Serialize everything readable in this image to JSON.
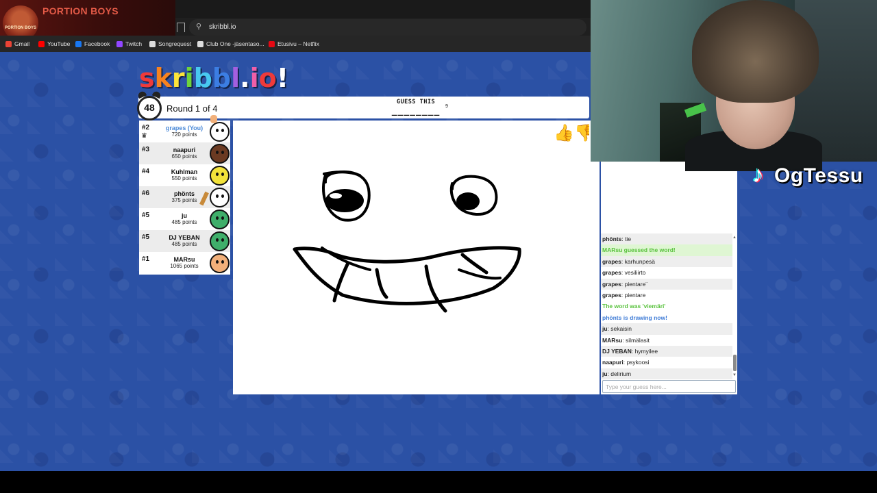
{
  "browser": {
    "url": "skribbl.io",
    "bookmarks": [
      {
        "label": "Gmail",
        "icon": "gmail-icon",
        "color": "#ea4335"
      },
      {
        "label": "YouTube",
        "icon": "youtube-icon",
        "color": "#ff0000"
      },
      {
        "label": "Facebook",
        "icon": "facebook-icon",
        "color": "#1877f2"
      },
      {
        "label": "Twitch",
        "icon": "twitch-icon",
        "color": "#9146ff"
      },
      {
        "label": "Songrequest",
        "icon": "diamond-icon",
        "color": "#dddddd"
      },
      {
        "label": "Club One -jäsentaso...",
        "icon": "club-icon",
        "color": "#dddddd"
      },
      {
        "label": "Etusivu – Netflix",
        "icon": "netflix-icon",
        "color": "#e50914"
      }
    ]
  },
  "banner": {
    "title": "PORTION BOYS",
    "logo_text": "PORTION BOYS"
  },
  "game": {
    "logo_letters": [
      "s",
      "k",
      "r",
      "i",
      "b",
      "b",
      "l",
      ".",
      "i",
      "o",
      "!"
    ],
    "logo_colors": [
      "#ef3a3a",
      "#f7821f",
      "#fde53a",
      "#6fd33c",
      "#48c8f0",
      "#3c7ee3",
      "#a45fe0",
      "#ffffff",
      "#ef5fa8",
      "#ef3a3a",
      "#ffffff"
    ],
    "timer": "48",
    "round": "Round 1 of 4",
    "guess_label": "GUESS THIS",
    "word_hint": "________",
    "word_length": "9",
    "players": [
      {
        "rank": "#2",
        "name": "grapes (You)",
        "points": "720 points",
        "is_you": true,
        "crown": true,
        "avatar_color": "#ffffff"
      },
      {
        "rank": "#3",
        "name": "naapuri",
        "points": "650 points",
        "avatar_color": "#6b3a22"
      },
      {
        "rank": "#4",
        "name": "Kuhlman",
        "points": "550 points",
        "avatar_color": "#f2e23a"
      },
      {
        "rank": "#6",
        "name": "phönts",
        "points": "375 points",
        "drawing": true,
        "avatar_color": "#ffffff"
      },
      {
        "rank": "#5",
        "name": "ju",
        "points": "485 points",
        "avatar_color": "#3fae6a"
      },
      {
        "rank": "#5",
        "name": "DJ YEBAN",
        "points": "485 points",
        "avatar_color": "#3fae6a"
      },
      {
        "rank": "#1",
        "name": "MARsu",
        "points": "1065 points",
        "avatar_color": "#f2b07a"
      }
    ]
  },
  "chat": {
    "messages": [
      {
        "user": "phönts",
        "text": "tie",
        "type": "normal"
      },
      {
        "user": "",
        "text": "MARsu guessed the word!",
        "type": "success"
      },
      {
        "user": "grapes",
        "text": "karhunpesä",
        "type": "normal"
      },
      {
        "user": "grapes",
        "text": "vesiliirto",
        "type": "normal"
      },
      {
        "user": "grapes",
        "text": "pientare¨",
        "type": "normal"
      },
      {
        "user": "grapes",
        "text": "pientare",
        "type": "normal"
      },
      {
        "user": "",
        "text": "The word was 'viemäri'",
        "type": "green"
      },
      {
        "user": "",
        "text": "phönts is drawing now!",
        "type": "blue"
      },
      {
        "user": "ju",
        "text": "sekaisin",
        "type": "normal"
      },
      {
        "user": "MARsu",
        "text": "silmälasit",
        "type": "normal"
      },
      {
        "user": "DJ YEBAN",
        "text": "hymyilee",
        "type": "normal"
      },
      {
        "user": "naapuri",
        "text": "psykoosi",
        "type": "normal"
      },
      {
        "user": "ju",
        "text": "delirium",
        "type": "normal"
      }
    ],
    "input_placeholder": "Type your guess here..."
  },
  "overlay": {
    "tiktok_handle": "OgTessu"
  }
}
